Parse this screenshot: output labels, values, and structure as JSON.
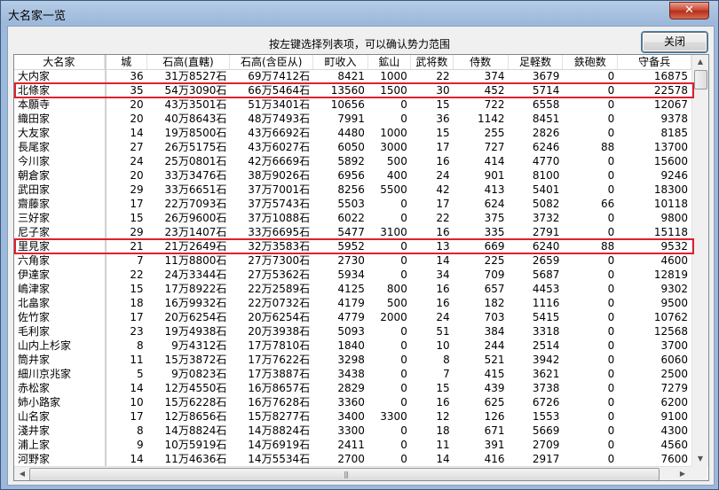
{
  "window": {
    "title": "大名家一览",
    "close_glyph": "✕",
    "instruction": "按左键选择列表项，可以确认势力范围",
    "close_button_label": "关闭"
  },
  "columns": [
    "大名家",
    "城",
    "石高(直轄)",
    "石高(含臣从)",
    "町收入",
    "鉱山",
    "武将数",
    "侍数",
    "足軽数",
    "鉄砲数",
    "守备兵"
  ],
  "highlighted_rows": [
    "北條家",
    "里見家"
  ],
  "highlight_color": "#e0202c",
  "rows": [
    [
      "大内家",
      "36",
      "31万8527石",
      "69万7412石",
      "8421",
      "1000",
      "22",
      "374",
      "3679",
      "0",
      "16875"
    ],
    [
      "北條家",
      "35",
      "54万3090石",
      "66万5464石",
      "13560",
      "1500",
      "30",
      "452",
      "5714",
      "0",
      "22578"
    ],
    [
      "本願寺",
      "20",
      "43万3501石",
      "51万3401石",
      "10656",
      "0",
      "15",
      "722",
      "6558",
      "0",
      "12067"
    ],
    [
      "織田家",
      "20",
      "40万8643石",
      "48万7493石",
      "7991",
      "0",
      "36",
      "1142",
      "8451",
      "0",
      "9378"
    ],
    [
      "大友家",
      "14",
      "19万8500石",
      "43万6692石",
      "4480",
      "1000",
      "15",
      "255",
      "2826",
      "0",
      "8185"
    ],
    [
      "長尾家",
      "27",
      "26万5175石",
      "43万6027石",
      "6050",
      "3000",
      "17",
      "727",
      "6246",
      "88",
      "13700"
    ],
    [
      "今川家",
      "24",
      "25万0801石",
      "42万6669石",
      "5892",
      "500",
      "16",
      "414",
      "4770",
      "0",
      "15600"
    ],
    [
      "朝倉家",
      "20",
      "33万3476石",
      "38万9026石",
      "6956",
      "400",
      "24",
      "901",
      "8100",
      "0",
      "9246"
    ],
    [
      "武田家",
      "29",
      "33万6651石",
      "37万7001石",
      "8256",
      "5500",
      "42",
      "413",
      "5401",
      "0",
      "18300"
    ],
    [
      "齋藤家",
      "17",
      "22万7093石",
      "37万5743石",
      "5503",
      "0",
      "17",
      "624",
      "5082",
      "66",
      "10118"
    ],
    [
      "三好家",
      "15",
      "26万9600石",
      "37万1088石",
      "6022",
      "0",
      "22",
      "375",
      "3732",
      "0",
      "9800"
    ],
    [
      "尼子家",
      "29",
      "23万1407石",
      "33万6695石",
      "5477",
      "3100",
      "16",
      "335",
      "2791",
      "0",
      "15118"
    ],
    [
      "里見家",
      "21",
      "21万2649石",
      "32万3583石",
      "5952",
      "0",
      "13",
      "669",
      "6240",
      "88",
      "9532"
    ],
    [
      "六角家",
      "7",
      "11万8800石",
      "27万7300石",
      "2730",
      "0",
      "14",
      "225",
      "2659",
      "0",
      "4600"
    ],
    [
      "伊達家",
      "22",
      "24万3344石",
      "27万5362石",
      "5934",
      "0",
      "34",
      "709",
      "5687",
      "0",
      "12819"
    ],
    [
      "嶋津家",
      "15",
      "17万8922石",
      "22万2589石",
      "4125",
      "800",
      "16",
      "657",
      "4453",
      "0",
      "9302"
    ],
    [
      "北畠家",
      "18",
      "16万9932石",
      "22万0732石",
      "4179",
      "500",
      "16",
      "182",
      "1116",
      "0",
      "9500"
    ],
    [
      "佐竹家",
      "17",
      "20万6254石",
      "20万6254石",
      "4779",
      "2000",
      "24",
      "703",
      "5415",
      "0",
      "10762"
    ],
    [
      "毛利家",
      "23",
      "19万4938石",
      "20万3938石",
      "5093",
      "0",
      "51",
      "384",
      "3318",
      "0",
      "12568"
    ],
    [
      "山内上杉家",
      "8",
      "9万4312石",
      "17万7810石",
      "1840",
      "0",
      "10",
      "244",
      "2514",
      "0",
      "3700"
    ],
    [
      "筒井家",
      "11",
      "15万3872石",
      "17万7622石",
      "3298",
      "0",
      "8",
      "521",
      "3942",
      "0",
      "6060"
    ],
    [
      "細川京兆家",
      "5",
      "9万0823石",
      "17万3887石",
      "3438",
      "0",
      "7",
      "415",
      "3621",
      "0",
      "2500"
    ],
    [
      "赤松家",
      "14",
      "12万4550石",
      "16万8657石",
      "2829",
      "0",
      "15",
      "439",
      "3738",
      "0",
      "7279"
    ],
    [
      "姉小路家",
      "10",
      "15万6228石",
      "16万7628石",
      "3360",
      "0",
      "16",
      "625",
      "6726",
      "0",
      "6200"
    ],
    [
      "山名家",
      "17",
      "12万8656石",
      "15万8277石",
      "3400",
      "3300",
      "12",
      "126",
      "1553",
      "0",
      "9100"
    ],
    [
      "淺井家",
      "8",
      "14万8824石",
      "14万8824石",
      "3300",
      "0",
      "18",
      "671",
      "5669",
      "0",
      "4300"
    ],
    [
      "浦上家",
      "9",
      "10万5919石",
      "14万6919石",
      "2411",
      "0",
      "11",
      "391",
      "2709",
      "0",
      "4560"
    ],
    [
      "河野家",
      "14",
      "11万4636石",
      "14万5534石",
      "2700",
      "0",
      "14",
      "416",
      "2917",
      "0",
      "7600"
    ]
  ]
}
